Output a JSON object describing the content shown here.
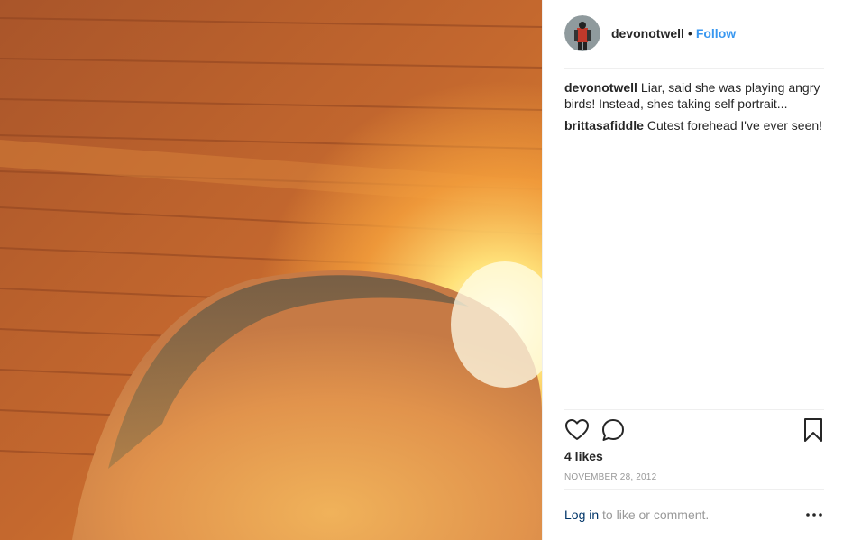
{
  "post": {
    "author": "devonotwell",
    "separator": "•",
    "follow_label": "Follow",
    "caption": {
      "user": "devonotwell",
      "text": "Liar, said she was playing angry birds! Instead, shes taking self portrait..."
    },
    "comments": [
      {
        "user": "brittasafiddle",
        "text": "Cutest forehead I've ever seen!"
      }
    ],
    "likes": "4 likes",
    "date": "NOVEMBER 28, 2012",
    "login_link": "Log in",
    "login_rest": " to like or comment."
  },
  "icons": {
    "like": "heart-icon",
    "comment": "comment-bubble-icon",
    "save": "bookmark-icon",
    "more": "more-options-icon"
  },
  "colors": {
    "link": "#3897f0",
    "login_link": "#003569",
    "muted": "#999999"
  }
}
